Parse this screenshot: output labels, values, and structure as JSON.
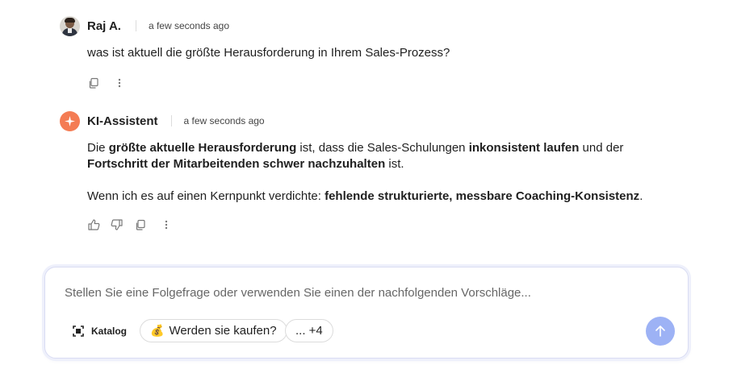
{
  "messages": [
    {
      "author": "Raj A.",
      "time": "a few seconds ago",
      "text": "was ist aktuell die größte Herausforderung in Ihrem Sales-Prozess?"
    },
    {
      "author": "KI-Assistent",
      "time": "a few seconds ago",
      "p1": [
        {
          "t": "Die ",
          "b": false
        },
        {
          "t": "größte aktuelle Herausforderung",
          "b": true
        },
        {
          "t": " ist, dass die Sales-Schulungen ",
          "b": false
        },
        {
          "t": "inkonsistent laufen",
          "b": true
        },
        {
          "t": " und der ",
          "b": false
        },
        {
          "t": "Fortschritt der Mitarbeitenden schwer nachzuhalten",
          "b": true
        },
        {
          "t": " ist.",
          "b": false
        }
      ],
      "p2": [
        {
          "t": "Wenn ich es auf einen Kernpunkt verdichte: ",
          "b": false
        },
        {
          "t": "fehlende strukturierte, messbare Coaching-Konsistenz",
          "b": true
        },
        {
          "t": ".",
          "b": false
        }
      ]
    }
  ],
  "composer": {
    "placeholder": "Stellen Sie eine Folgefrage oder verwenden Sie einen der nachfolgenden Vorschläge...",
    "catalog_label": "Katalog",
    "suggestions": [
      {
        "emoji": "💰",
        "label": "Werden sie kaufen?"
      },
      {
        "emoji": "",
        "label": "... +4"
      }
    ]
  },
  "colors": {
    "ai_avatar": "#f47c54",
    "send_button": "#9db2f5",
    "composer_border": "#d9dcf3"
  },
  "icons": [
    "copy-icon",
    "more-vertical-icon",
    "thumbs-up-icon",
    "thumbs-down-icon",
    "sparkle-icon",
    "catalog-scan-icon",
    "arrow-up-icon"
  ]
}
